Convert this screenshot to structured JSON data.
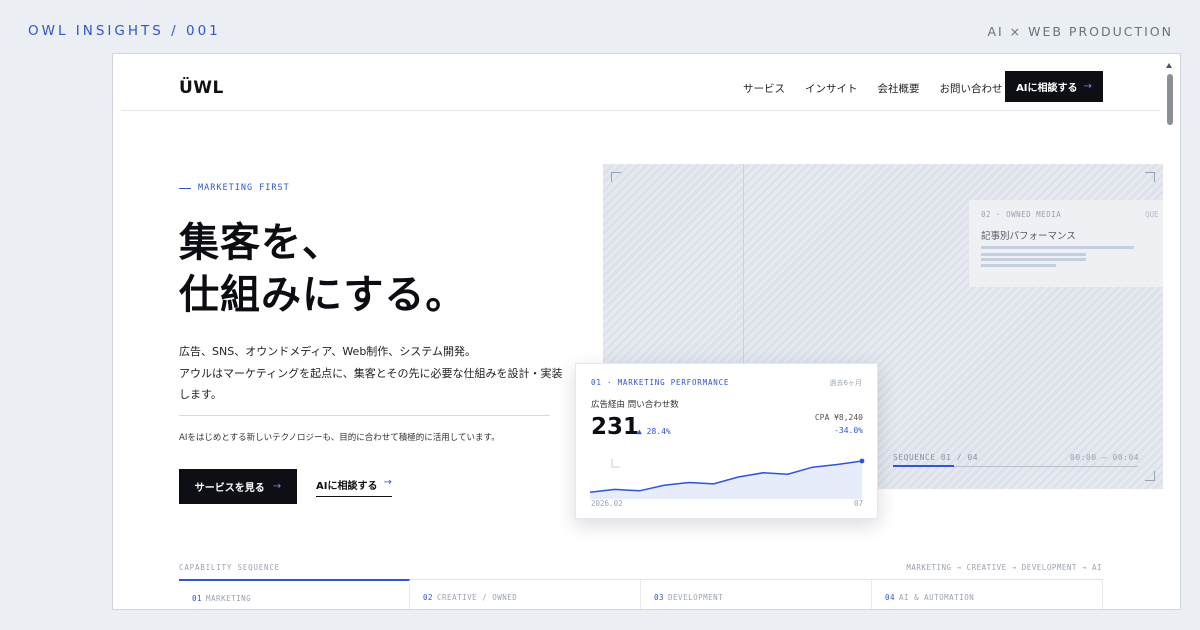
{
  "page": {
    "top_left": "OWL INSIGHTS / 001",
    "top_right": "AI × WEB PRODUCTION"
  },
  "header": {
    "logo": "ÜWL",
    "nav": [
      "サービス",
      "インサイト",
      "会社概要",
      "お問い合わせ"
    ],
    "cta_label": "AIに相談する",
    "cta_arrow": "→"
  },
  "hero": {
    "eyebrow": "MARKETING FIRST",
    "headline_line1": "集客を、",
    "headline_line2": "仕組みにする。",
    "body_line1": "広告、SNS、オウンドメディア、Web制作、システム開発。",
    "body_line2": "アウルはマーケティングを起点に、集客とその先に必要な仕組みを設計・実装",
    "body_line3": "します。",
    "body_small": "AIをはじめとする新しいテクノロジーも、目的に合わせて積極的に活用しています。",
    "primary_button": "サービスを見る",
    "secondary_link": "AIに相談する",
    "arrow": "→"
  },
  "owned_media": {
    "label": "02 · OWNED MEDIA",
    "label_ghost": "QUE",
    "title": "記事別パフォーマンス",
    "bar_fill": [
      0.9,
      0.62,
      0.62,
      0.44
    ]
  },
  "sequence": {
    "label": "SEQUENCE 01 / 04",
    "time": "00:00 — 00:04",
    "progress": 0.25
  },
  "performance_card": {
    "label": "01 · MARKETING PERFORMANCE",
    "period": "過去6ヶ月",
    "subtitle": "広告経由 問い合わせ数",
    "value": "231",
    "delta": "▲ 28.4%",
    "cpa": "CPA ¥8,240",
    "cpa_delta": "-34.0%",
    "x_start": "2026.02",
    "x_end": "07",
    "accent": "#2d55d6"
  },
  "chart_data": {
    "type": "area",
    "xlabel": "",
    "ylabel": "",
    "values": [
      186,
      190,
      188,
      196,
      200,
      198,
      208,
      214,
      212,
      222,
      226,
      231
    ]
  },
  "capability": {
    "label": "CAPABILITY SEQUENCE",
    "flow": "MARKETING → CREATIVE → DEVELOPMENT → AI",
    "columns": [
      {
        "num": "01",
        "name": "MARKETING"
      },
      {
        "num": "02",
        "name": "CREATIVE / OWNED"
      },
      {
        "num": "03",
        "name": "DEVELOPMENT"
      },
      {
        "num": "04",
        "name": "AI & AUTOMATION"
      }
    ]
  }
}
